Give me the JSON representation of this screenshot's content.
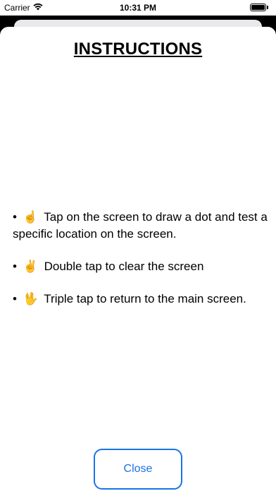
{
  "status_bar": {
    "carrier": "Carrier",
    "time": "10:31 PM",
    "icons": [
      "wifi-icon",
      "battery-icon"
    ]
  },
  "sheet": {
    "title": "INSTRUCTIONS",
    "instructions": [
      {
        "bullet": "•",
        "emoji": "☝️",
        "text": "Tap on the screen to draw a dot and test a specific location on the screen."
      },
      {
        "bullet": "•",
        "emoji": "✌️",
        "text": "Double tap to clear the screen"
      },
      {
        "bullet": "•",
        "emoji": "🖖",
        "text": "Triple tap to return to the main screen."
      }
    ],
    "close_label": "Close"
  },
  "colors": {
    "accent": "#1a73e8",
    "background": "#ffffff",
    "text": "#000000"
  }
}
